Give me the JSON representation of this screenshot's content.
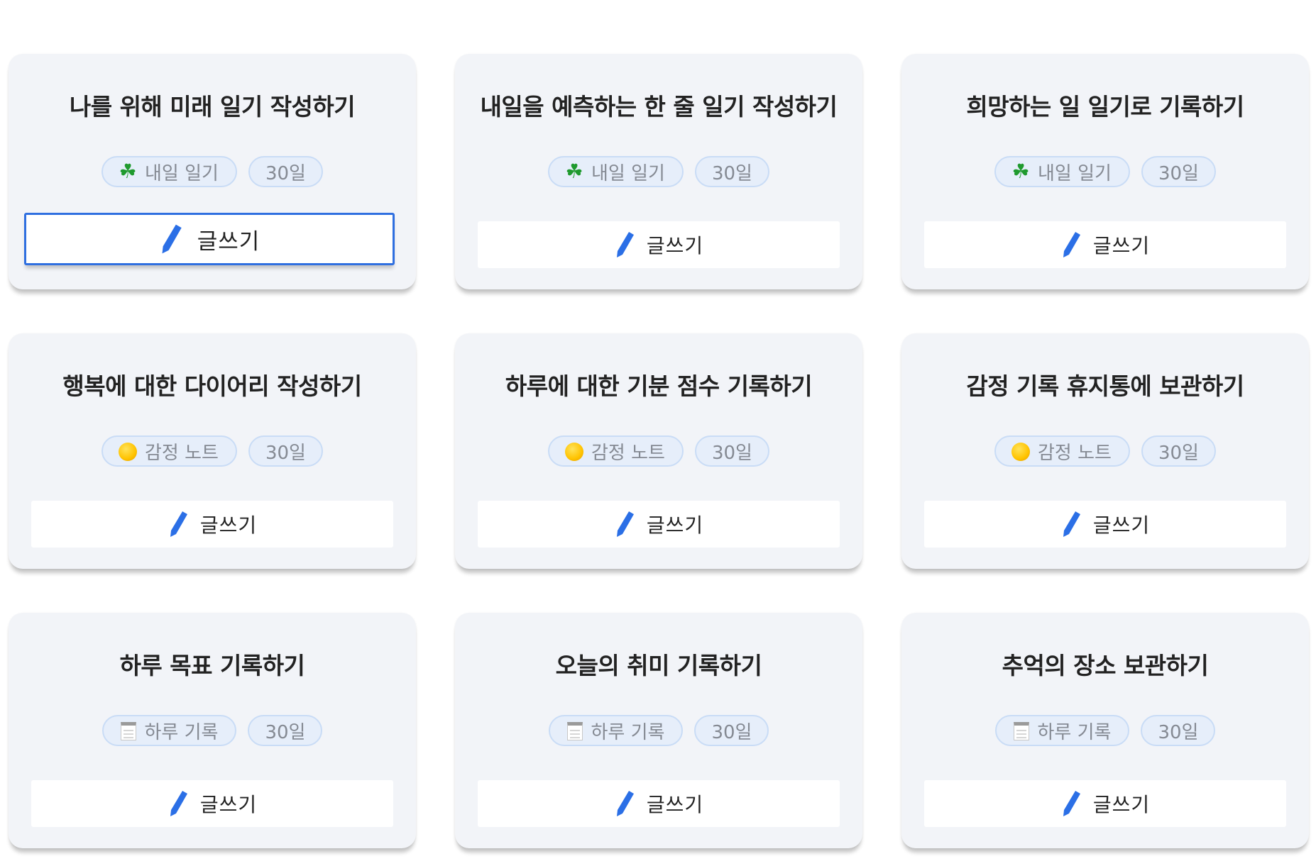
{
  "accent_color": "#2f6fe0",
  "cards": [
    {
      "title": "나를 위해 미래 일기 작성하기",
      "category": "내일 일기",
      "category_icon": "clover-icon",
      "days": "30일",
      "button_label": "글쓰기",
      "focused": true
    },
    {
      "title": "내일을 예측하는 한 줄 일기 작성하기",
      "category": "내일 일기",
      "category_icon": "clover-icon",
      "days": "30일",
      "button_label": "글쓰기",
      "focused": false
    },
    {
      "title": "희망하는 일 일기로 기록하기",
      "category": "내일 일기",
      "category_icon": "clover-icon",
      "days": "30일",
      "button_label": "글쓰기",
      "focused": false
    },
    {
      "title": "행복에 대한 다이어리 작성하기",
      "category": "감정 노트",
      "category_icon": "sun-icon",
      "days": "30일",
      "button_label": "글쓰기",
      "focused": false
    },
    {
      "title": "하루에 대한 기분 점수 기록하기",
      "category": "감정 노트",
      "category_icon": "sun-icon",
      "days": "30일",
      "button_label": "글쓰기",
      "focused": false
    },
    {
      "title": "감정 기록 휴지통에 보관하기",
      "category": "감정 노트",
      "category_icon": "sun-icon",
      "days": "30일",
      "button_label": "글쓰기",
      "focused": false
    },
    {
      "title": "하루 목표 기록하기",
      "category": "하루 기록",
      "category_icon": "notepad-icon",
      "days": "30일",
      "button_label": "글쓰기",
      "focused": false
    },
    {
      "title": "오늘의 취미 기록하기",
      "category": "하루 기록",
      "category_icon": "notepad-icon",
      "days": "30일",
      "button_label": "글쓰기",
      "focused": false
    },
    {
      "title": "추억의 장소 보관하기",
      "category": "하루 기록",
      "category_icon": "notepad-icon",
      "days": "30일",
      "button_label": "글쓰기",
      "focused": false
    }
  ]
}
